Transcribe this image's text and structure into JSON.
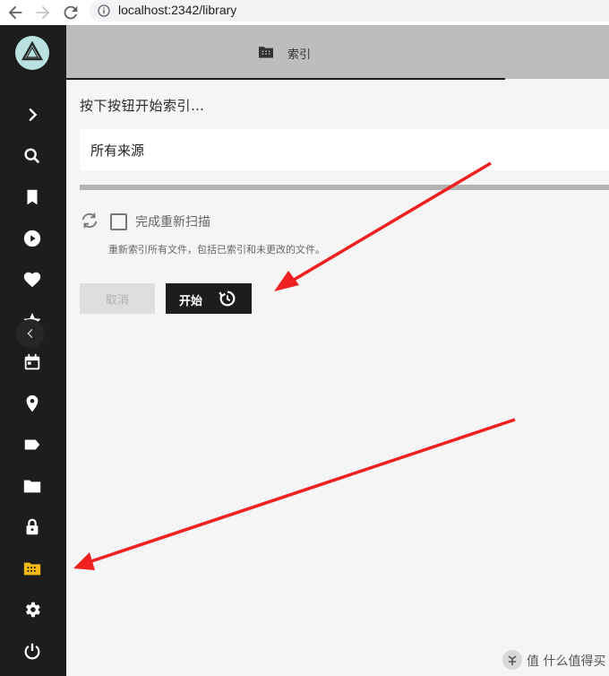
{
  "browser": {
    "url": "localhost:2342/library"
  },
  "sidebar": {
    "items": [
      {
        "icon": "chevron-right-icon"
      },
      {
        "icon": "search-icon"
      },
      {
        "icon": "bookmark-icon"
      },
      {
        "icon": "play-circle-icon"
      },
      {
        "icon": "heart-icon"
      },
      {
        "icon": "star-icon"
      },
      {
        "icon": "calendar-icon"
      },
      {
        "icon": "location-pin-icon"
      },
      {
        "icon": "label-tag-icon"
      },
      {
        "icon": "folder-icon"
      },
      {
        "icon": "lock-icon"
      },
      {
        "icon": "library-folder-icon",
        "active": true,
        "color": "#f5b915"
      },
      {
        "icon": "settings-gear-icon"
      },
      {
        "icon": "power-icon"
      }
    ]
  },
  "tabs": {
    "index_label": "索引"
  },
  "main": {
    "hint": "按下按钮开始索引…",
    "source_value": "所有来源",
    "rescan_label": "完成重新扫描",
    "rescan_desc": "重新索引所有文件，包括已索引和未更改的文件。",
    "cancel_label": "取消",
    "start_label": "开始"
  },
  "watermark": {
    "text": "值 什么值得买"
  },
  "colors": {
    "sidebar_bg": "#1d1d1d",
    "accent_active": "#f5b915",
    "annotation_arrow": "#f02020"
  }
}
